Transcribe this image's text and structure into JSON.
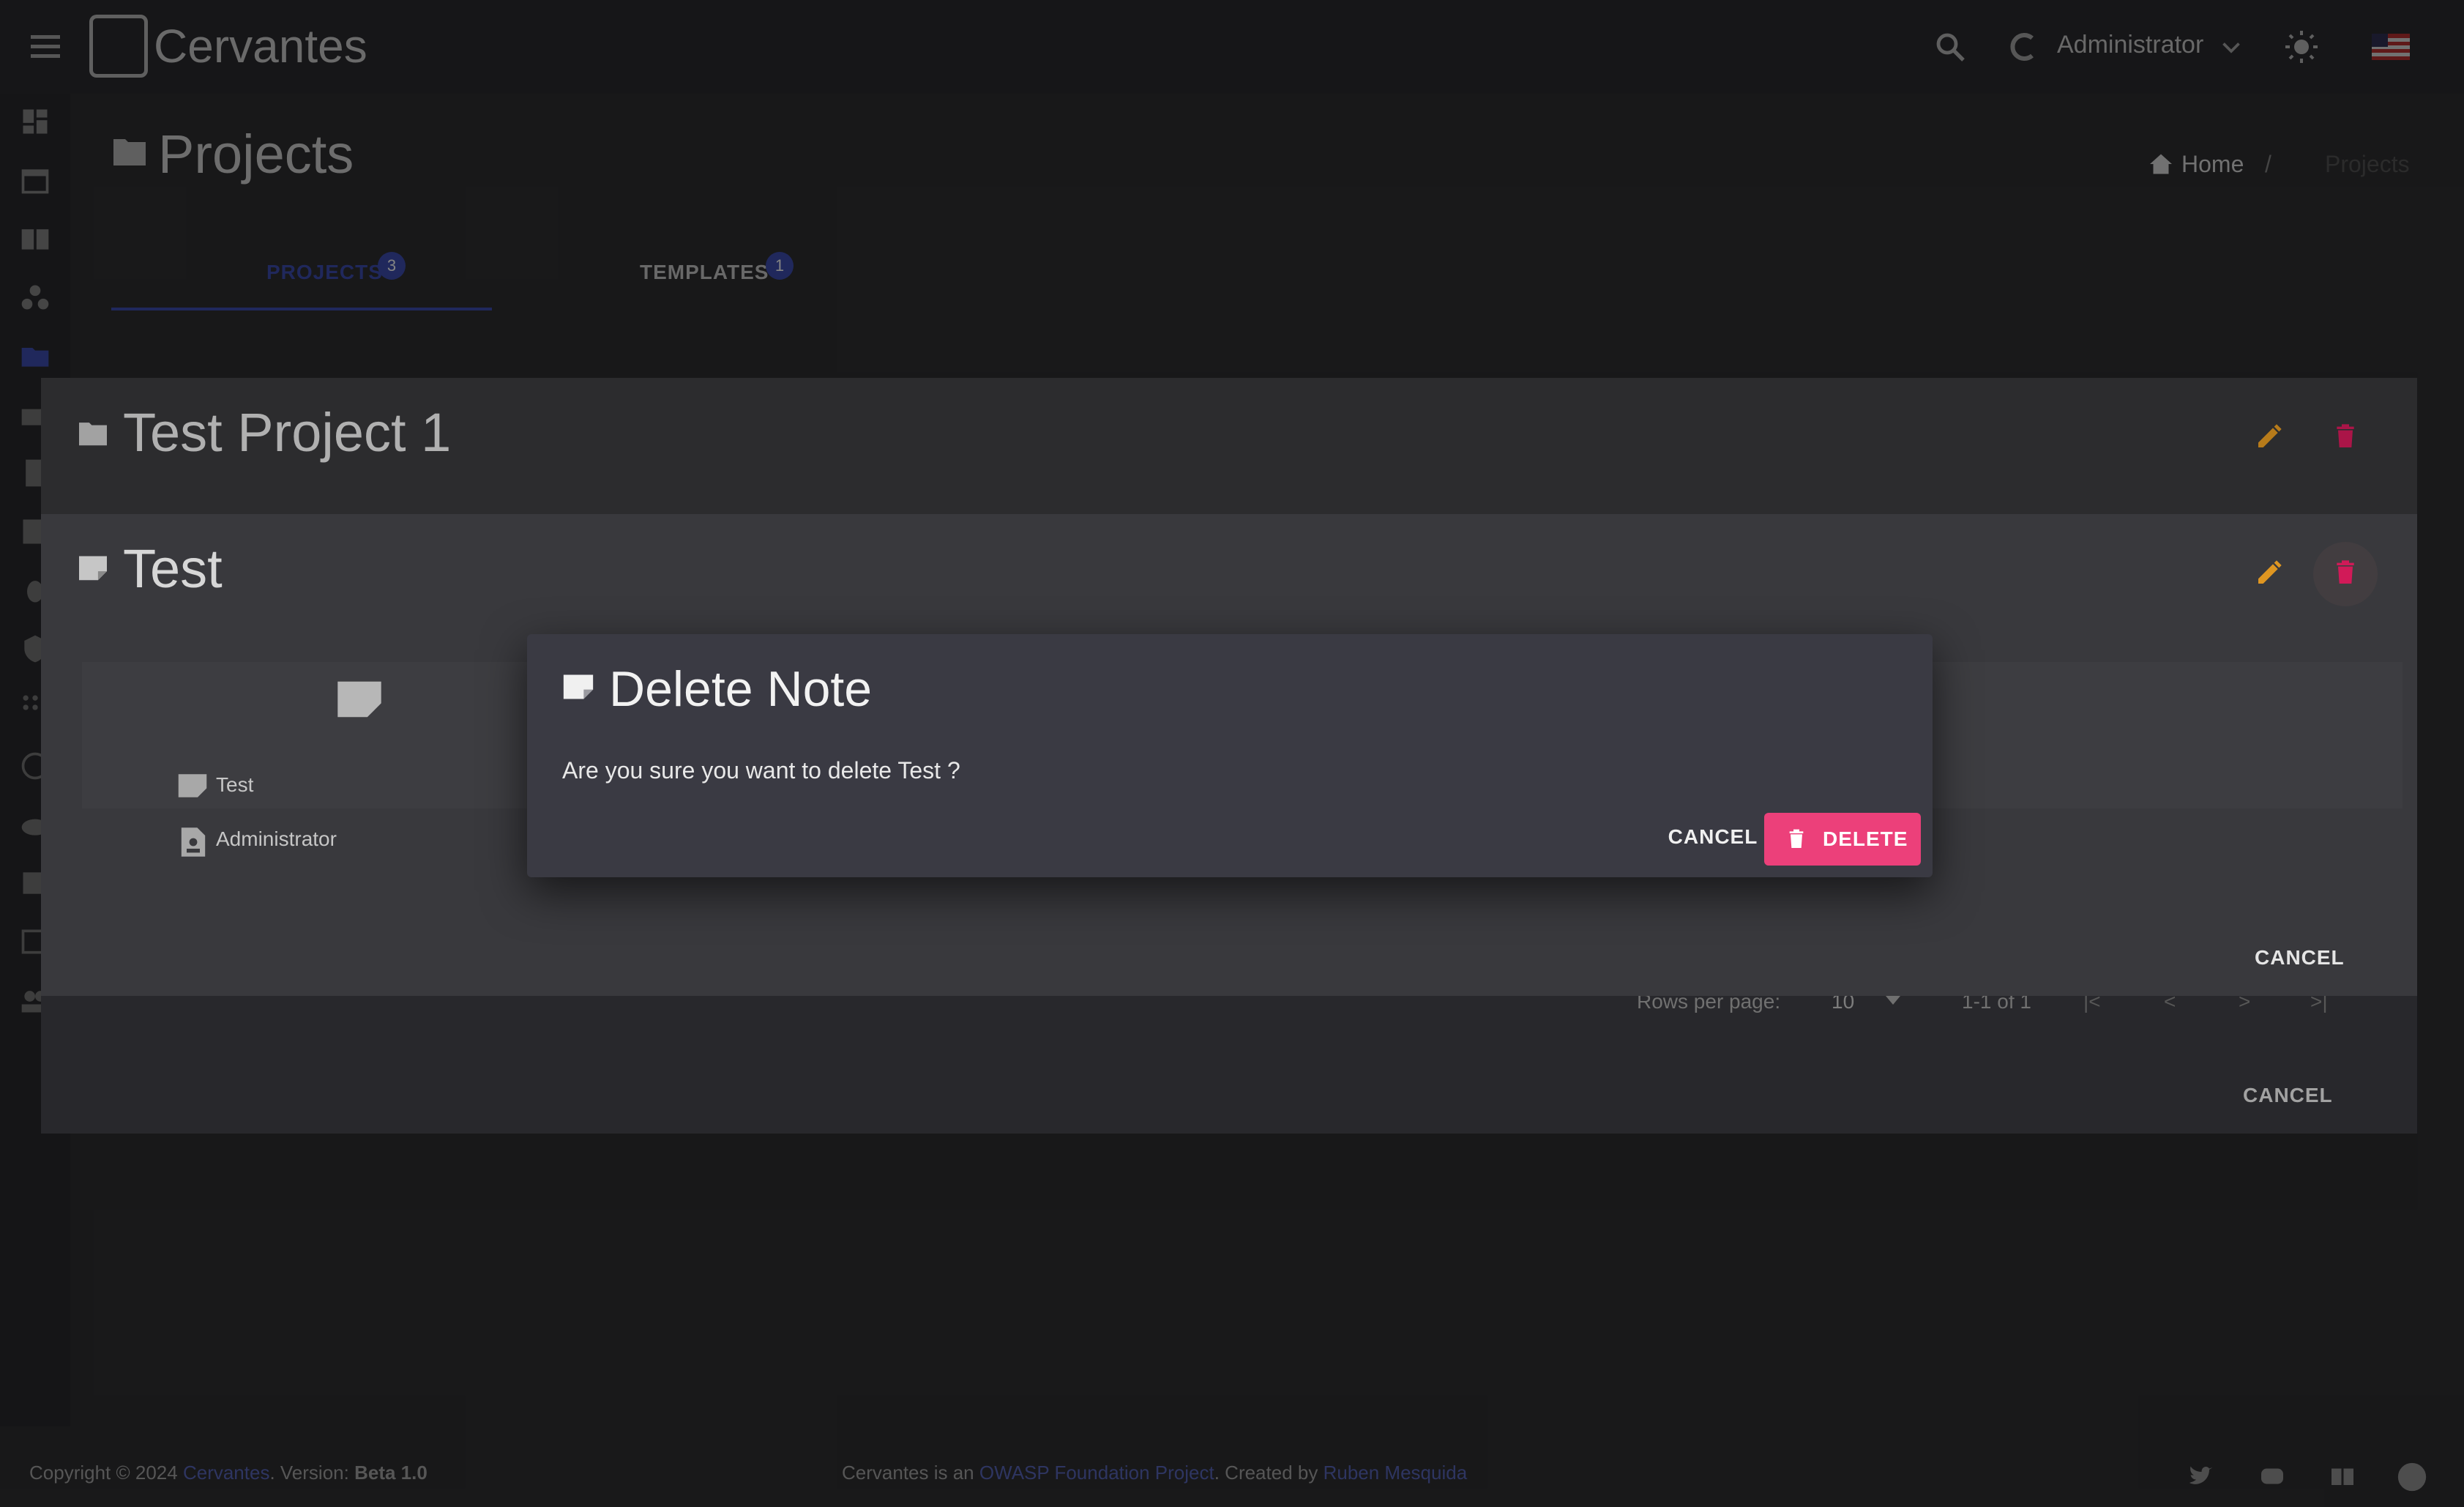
{
  "app": {
    "name": "Cervantes",
    "user": "Administrator"
  },
  "page": {
    "title": "Projects",
    "breadcrumb": {
      "home": "Home",
      "current": "Projects"
    },
    "tabs": [
      {
        "label": "PROJECTS",
        "badge": "3"
      },
      {
        "label": "TEMPLATES",
        "badge": "1"
      }
    ]
  },
  "project_dialog": {
    "title": "Test Project 1",
    "cancel_label": "CANCEL"
  },
  "note_dialog": {
    "title": "Test",
    "fields": [
      {
        "value": "Test"
      },
      {
        "value": "Administrator"
      }
    ],
    "cancel_label": "CANCEL"
  },
  "pagination": {
    "rows_per_page_label": "Rows per page:",
    "rows_per_page": "10",
    "range": "1-1 of 1"
  },
  "delete_dialog": {
    "title": "Delete Note",
    "message": "Are you sure you want to delete Test ?",
    "cancel_label": "CANCEL",
    "delete_label": "DELETE"
  },
  "footer": {
    "copyright_prefix": "Copyright © 2024",
    "brand_link": "Cervantes",
    "version_prefix": ". Version:",
    "version": "Beta 1.0",
    "middle_prefix": "Cervantes is an",
    "owasp_link": "OWASP Foundation Project",
    "created_by": ". Created by",
    "author_link": "Ruben Mesquida"
  },
  "colors": {
    "accent": "#ec407a",
    "primary": "#3f51b5",
    "edit": "#f9a825",
    "delete": "#e91e63"
  }
}
